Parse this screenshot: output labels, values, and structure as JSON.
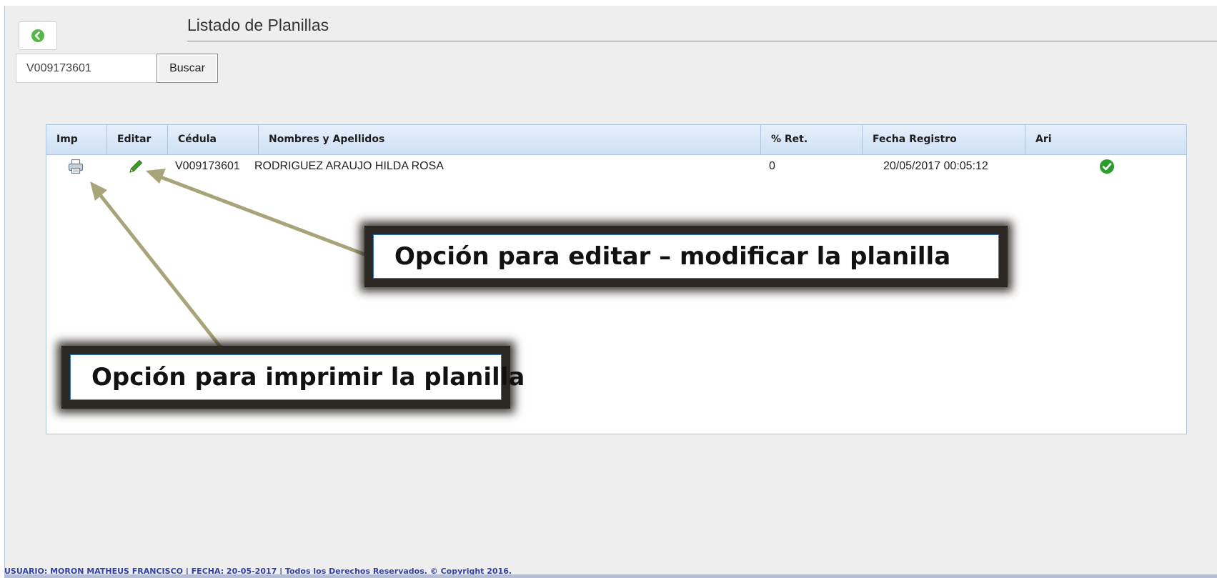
{
  "header": {
    "title": "Listado de Planillas"
  },
  "search": {
    "value": "V009173601",
    "button_label": "Buscar"
  },
  "table": {
    "columns": [
      "Imp",
      "Editar",
      "Cédula",
      "Nombres y Apellidos",
      "% Ret.",
      "Fecha Registro",
      "Ari"
    ],
    "rows": [
      {
        "print_icon": "printer-icon",
        "edit_icon": "pencil-icon",
        "cedula": "V009173601",
        "nombres": "RODRIGUEZ ARAUJO HILDA ROSA",
        "ret": "0",
        "fecha": "20/05/2017 00:05:12",
        "ari_icon": "check-circle-icon"
      }
    ]
  },
  "annotations": {
    "edit_note": "Opción para editar – modificar  la planilla",
    "print_note": "Opción para imprimir la planilla"
  },
  "footer": {
    "text": "USUARIO: MORON MATHEUS FRANCISCO | FECHA: 20-05-2017 | Todos los Derechos Reservados. © Copyright 2016."
  },
  "colors": {
    "accent_green": "#5aae2e",
    "header_blue": "#cfe1f5",
    "footer_text": "#2f3fa8",
    "arrow": "#a8a378"
  },
  "icons": {
    "back": "circle-arrow-left-icon"
  }
}
